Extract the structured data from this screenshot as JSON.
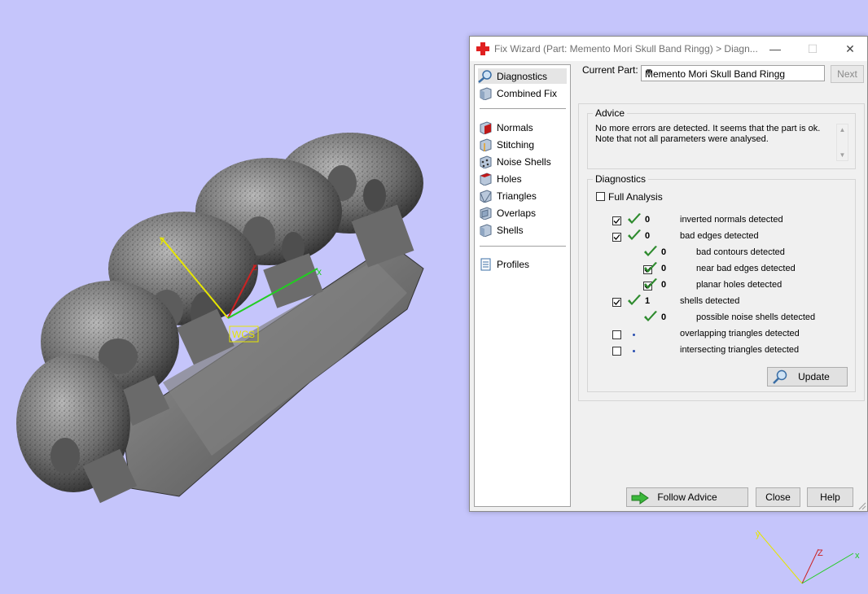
{
  "viewport": {
    "wcs_label": "WCS",
    "axis_x": "x",
    "axis_y": "y",
    "axis_z": "z",
    "mini_axis_z": "Z"
  },
  "window": {
    "title": "Fix Wizard (Part: Memento Mori Skull Band Ringg) > Diagn...",
    "controls": {
      "minimize": "—",
      "maximize": "☐",
      "close": "✕"
    }
  },
  "nav": {
    "items": [
      {
        "label": "Diagnostics",
        "icon": "magnifier-icon",
        "selected": true
      },
      {
        "label": "Combined Fix",
        "icon": "cube-icon"
      },
      {
        "label": "Normals",
        "icon": "normals-cube-icon"
      },
      {
        "label": "Stitching",
        "icon": "stitching-cube-icon"
      },
      {
        "label": "Noise Shells",
        "icon": "noise-shells-icon"
      },
      {
        "label": "Holes",
        "icon": "holes-cube-icon"
      },
      {
        "label": "Triangles",
        "icon": "triangles-cube-icon"
      },
      {
        "label": "Overlaps",
        "icon": "overlaps-cube-icon"
      },
      {
        "label": "Shells",
        "icon": "shells-cube-icon"
      },
      {
        "label": "Profiles",
        "icon": "document-icon"
      }
    ]
  },
  "header": {
    "current_part_label": "Current Part:",
    "current_part_value": "Memento Mori Skull Band Ringg",
    "next_label": "Next"
  },
  "advice": {
    "title": "Advice",
    "text_line1": "No more errors are detected. It seems that the part is ok.",
    "text_line2": "Note that not all parameters were analysed."
  },
  "diagnostics": {
    "title": "Diagnostics",
    "full_analysis_label": "Full Analysis",
    "full_analysis_checked": false,
    "rows": [
      {
        "checked": true,
        "status": "ok",
        "count": "0",
        "label": "inverted normals detected",
        "indent": 0,
        "has_checkbox": true
      },
      {
        "checked": true,
        "status": "ok",
        "count": "0",
        "label": "bad edges detected",
        "indent": 0,
        "has_checkbox": true
      },
      {
        "checked": false,
        "status": "ok",
        "count": "0",
        "label": "bad contours detected",
        "indent": 1,
        "has_checkbox": false
      },
      {
        "checked": true,
        "status": "ok",
        "count": "0",
        "label": "near bad edges detected",
        "indent": 1,
        "has_checkbox": true
      },
      {
        "checked": true,
        "status": "ok",
        "count": "0",
        "label": "planar holes detected",
        "indent": 1,
        "has_checkbox": true
      },
      {
        "checked": true,
        "status": "ok",
        "count": "1",
        "label": "shells detected",
        "indent": 0,
        "has_checkbox": true
      },
      {
        "checked": false,
        "status": "ok",
        "count": "0",
        "label": "possible noise shells detected",
        "indent": 1,
        "has_checkbox": false
      },
      {
        "checked": false,
        "status": "not-run",
        "count": "",
        "label": "overlapping triangles detected",
        "indent": 0,
        "has_checkbox": true
      },
      {
        "checked": false,
        "status": "not-run",
        "count": "",
        "label": "intersecting triangles detected",
        "indent": 0,
        "has_checkbox": true
      }
    ],
    "update_label": "Update"
  },
  "footer": {
    "follow_advice_label": "Follow Advice",
    "close_label": "Close",
    "help_label": "Help"
  },
  "colors": {
    "background": "#c5c5fb",
    "check_green": "#2e8b2e",
    "axis_x": "#22cc22",
    "axis_y": "#e6e600",
    "axis_z": "#cc2222"
  }
}
